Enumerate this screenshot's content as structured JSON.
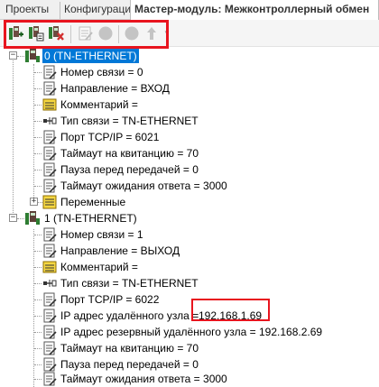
{
  "tabs": [
    {
      "label": "Проекты"
    },
    {
      "label": "Конфигурация"
    },
    {
      "label": "Мастер-модуль: Межконтроллерный обмен"
    }
  ],
  "toolbar": {
    "buttons": [
      {
        "icon": "add-node-icon",
        "enabled": true
      },
      {
        "icon": "copy-node-icon",
        "enabled": true
      },
      {
        "icon": "delete-node-icon",
        "enabled": true
      },
      {
        "icon": "properties-icon",
        "enabled": false
      },
      {
        "icon": "stop-icon",
        "enabled": false
      },
      {
        "icon": "record-icon",
        "enabled": false
      },
      {
        "icon": "arrow-up-icon",
        "enabled": false
      }
    ]
  },
  "tree": {
    "nodes": [
      {
        "label": "0 (TN-ETHERNET)",
        "children": [
          {
            "icon": "param",
            "label": "Номер связи = 0"
          },
          {
            "icon": "param",
            "label": "Направление = ВХОД"
          },
          {
            "icon": "comment",
            "label": "Комментарий ="
          },
          {
            "icon": "link",
            "label": "Тип связи = TN-ETHERNET"
          },
          {
            "icon": "param",
            "label": "Порт TCP/IP = 6021"
          },
          {
            "icon": "param",
            "label": "Таймаут на квитанцию = 70"
          },
          {
            "icon": "param",
            "label": "Пауза перед передачей = 0"
          },
          {
            "icon": "param",
            "label": "Таймаут ожидания ответа = 3000"
          },
          {
            "icon": "vars",
            "label": "Переменные"
          }
        ]
      },
      {
        "label": "1 (TN-ETHERNET)",
        "children": [
          {
            "icon": "param",
            "label": "Номер связи = 1"
          },
          {
            "icon": "param",
            "label": "Направление = ВЫХОД"
          },
          {
            "icon": "comment",
            "label": "Комментарий ="
          },
          {
            "icon": "link",
            "label": "Тип связи = TN-ETHERNET"
          },
          {
            "icon": "param",
            "label": "Порт TCP/IP = 6022"
          },
          {
            "icon": "param",
            "label": "IP адрес удалённого узла =",
            "value": "192.168.1.69"
          },
          {
            "icon": "param",
            "label": "IP адрес резервный удалённого узла = 192.168.2.69"
          },
          {
            "icon": "param",
            "label": "Таймаут на квитанцию = 70"
          },
          {
            "icon": "param",
            "label": "Пауза перед передачей = 0"
          },
          {
            "icon": "param",
            "label": "Таймаут ожидания ответа = 3000"
          }
        ]
      }
    ]
  },
  "colors": {
    "highlight": "#e8141e",
    "selection": "#0078d7"
  }
}
